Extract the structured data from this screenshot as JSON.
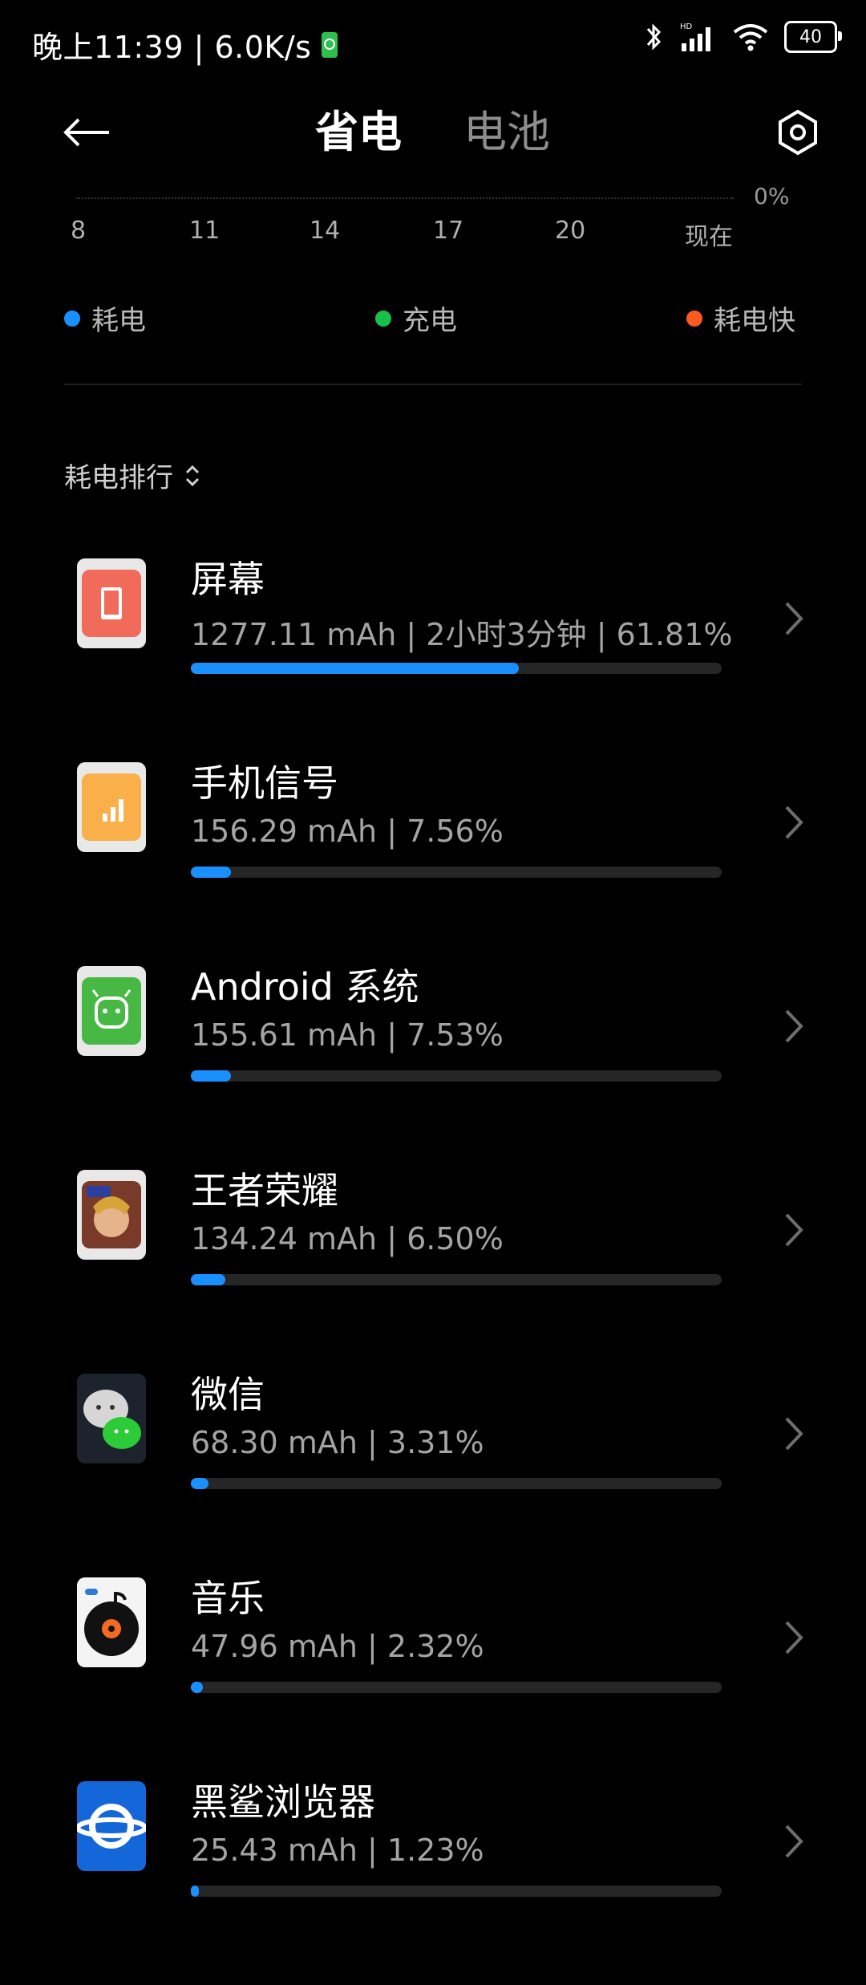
{
  "status_bar": {
    "time_speed": "晚上11:39 | 6.0K/s",
    "battery_level": "40"
  },
  "header": {
    "tab_active": "省电",
    "tab_inactive": "电池"
  },
  "chart": {
    "y_top_label": "0%",
    "x_ticks": [
      "8",
      "11",
      "14",
      "17",
      "20",
      "现在"
    ]
  },
  "legend": {
    "items": [
      {
        "label": "耗电",
        "color": "#1a90ff"
      },
      {
        "label": "充电",
        "color": "#18c04c"
      },
      {
        "label": "耗电快",
        "color": "#ff5a1f"
      }
    ]
  },
  "rank": {
    "title": "耗电排行"
  },
  "apps": [
    {
      "name": "屏幕",
      "detail": "1277.11 mAh | 2小时3分钟 | 61.81%",
      "percent": 61.81,
      "icon": "screen-icon"
    },
    {
      "name": "手机信号",
      "detail": "156.29 mAh | 7.56%",
      "percent": 7.56,
      "icon": "signal-icon"
    },
    {
      "name": "Android 系统",
      "detail": "155.61 mAh | 7.53%",
      "percent": 7.53,
      "icon": "android-icon"
    },
    {
      "name": "王者荣耀",
      "detail": "134.24 mAh | 6.50%",
      "percent": 6.5,
      "icon": "game-icon"
    },
    {
      "name": "微信",
      "detail": "68.30 mAh | 3.31%",
      "percent": 3.31,
      "icon": "wechat-icon"
    },
    {
      "name": "音乐",
      "detail": "47.96 mAh | 2.32%",
      "percent": 2.32,
      "icon": "music-icon"
    },
    {
      "name": "黑鲨浏览器",
      "detail": "25.43 mAh | 1.23%",
      "percent": 1.23,
      "icon": "browser-icon"
    }
  ]
}
